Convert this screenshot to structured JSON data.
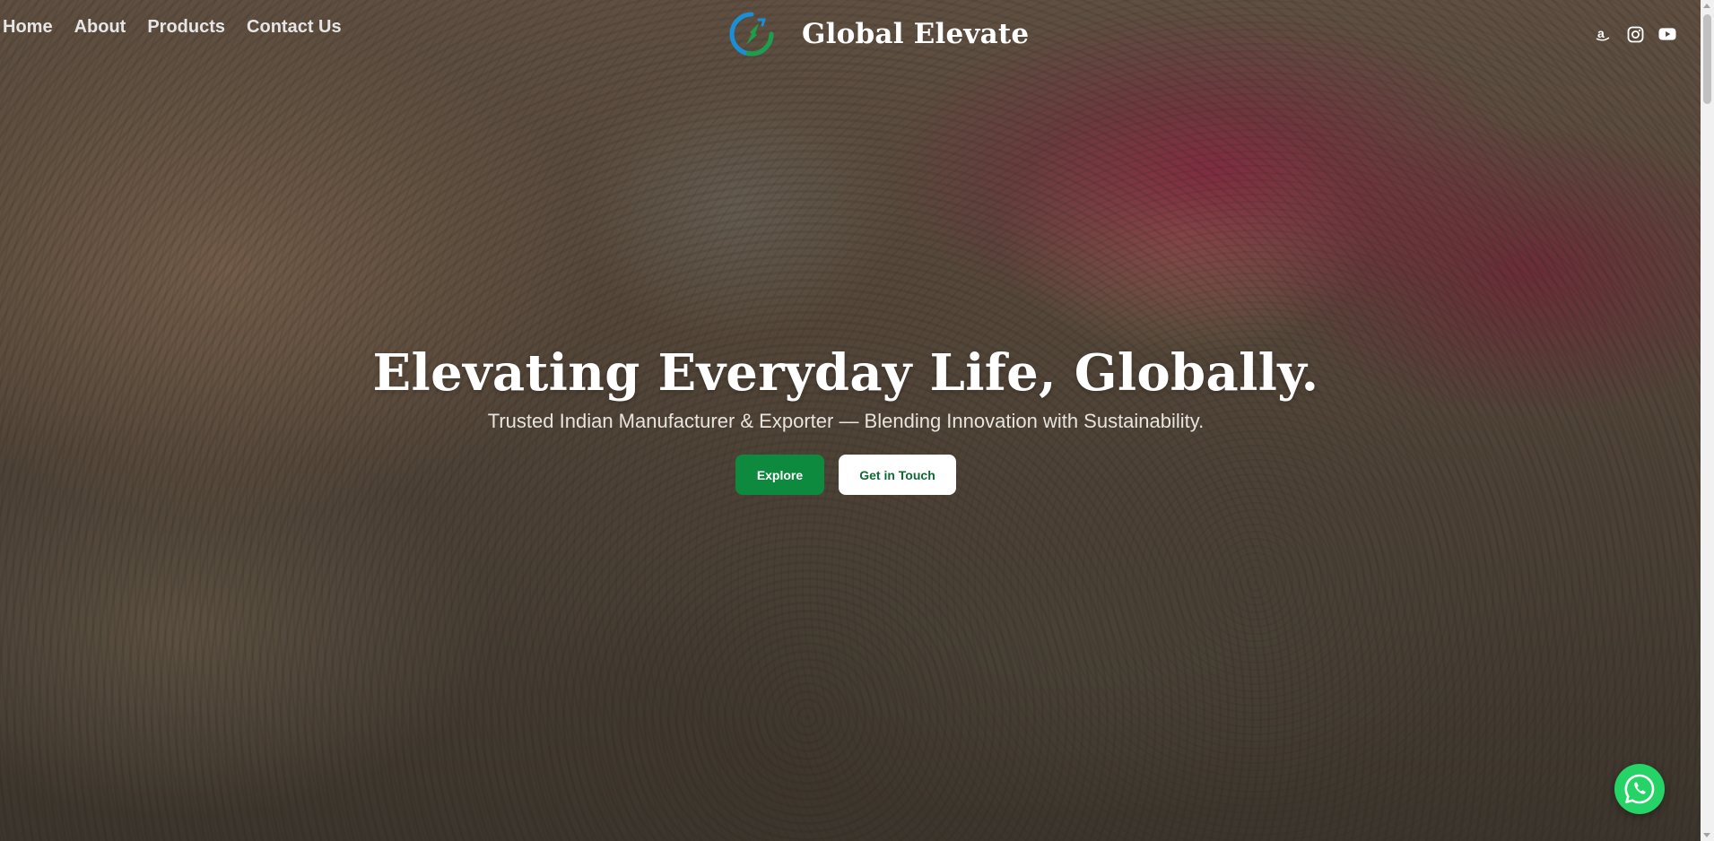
{
  "nav": {
    "items": [
      {
        "label": "Home"
      },
      {
        "label": "About"
      },
      {
        "label": "Products"
      },
      {
        "label": "Contact Us"
      }
    ]
  },
  "brand": {
    "name": "Global Elevate",
    "logo_icon": "global-elevate-logo-icon"
  },
  "social": {
    "icons": [
      "amazon-icon",
      "instagram-icon",
      "youtube-icon"
    ]
  },
  "hero": {
    "title": "Elevating Everyday Life, Globally.",
    "subtitle": "Trusted Indian Manufacturer & Exporter — Blending Innovation with Sustainability.",
    "primary_button": "Explore",
    "secondary_button": "Get in Touch"
  },
  "whatsapp": {
    "icon": "whatsapp-icon"
  },
  "colors": {
    "primary_green": "#0e8a3e",
    "whatsapp_green": "#25d366",
    "logo_blue": "#1b8fd6",
    "logo_green": "#1e9e4a"
  }
}
